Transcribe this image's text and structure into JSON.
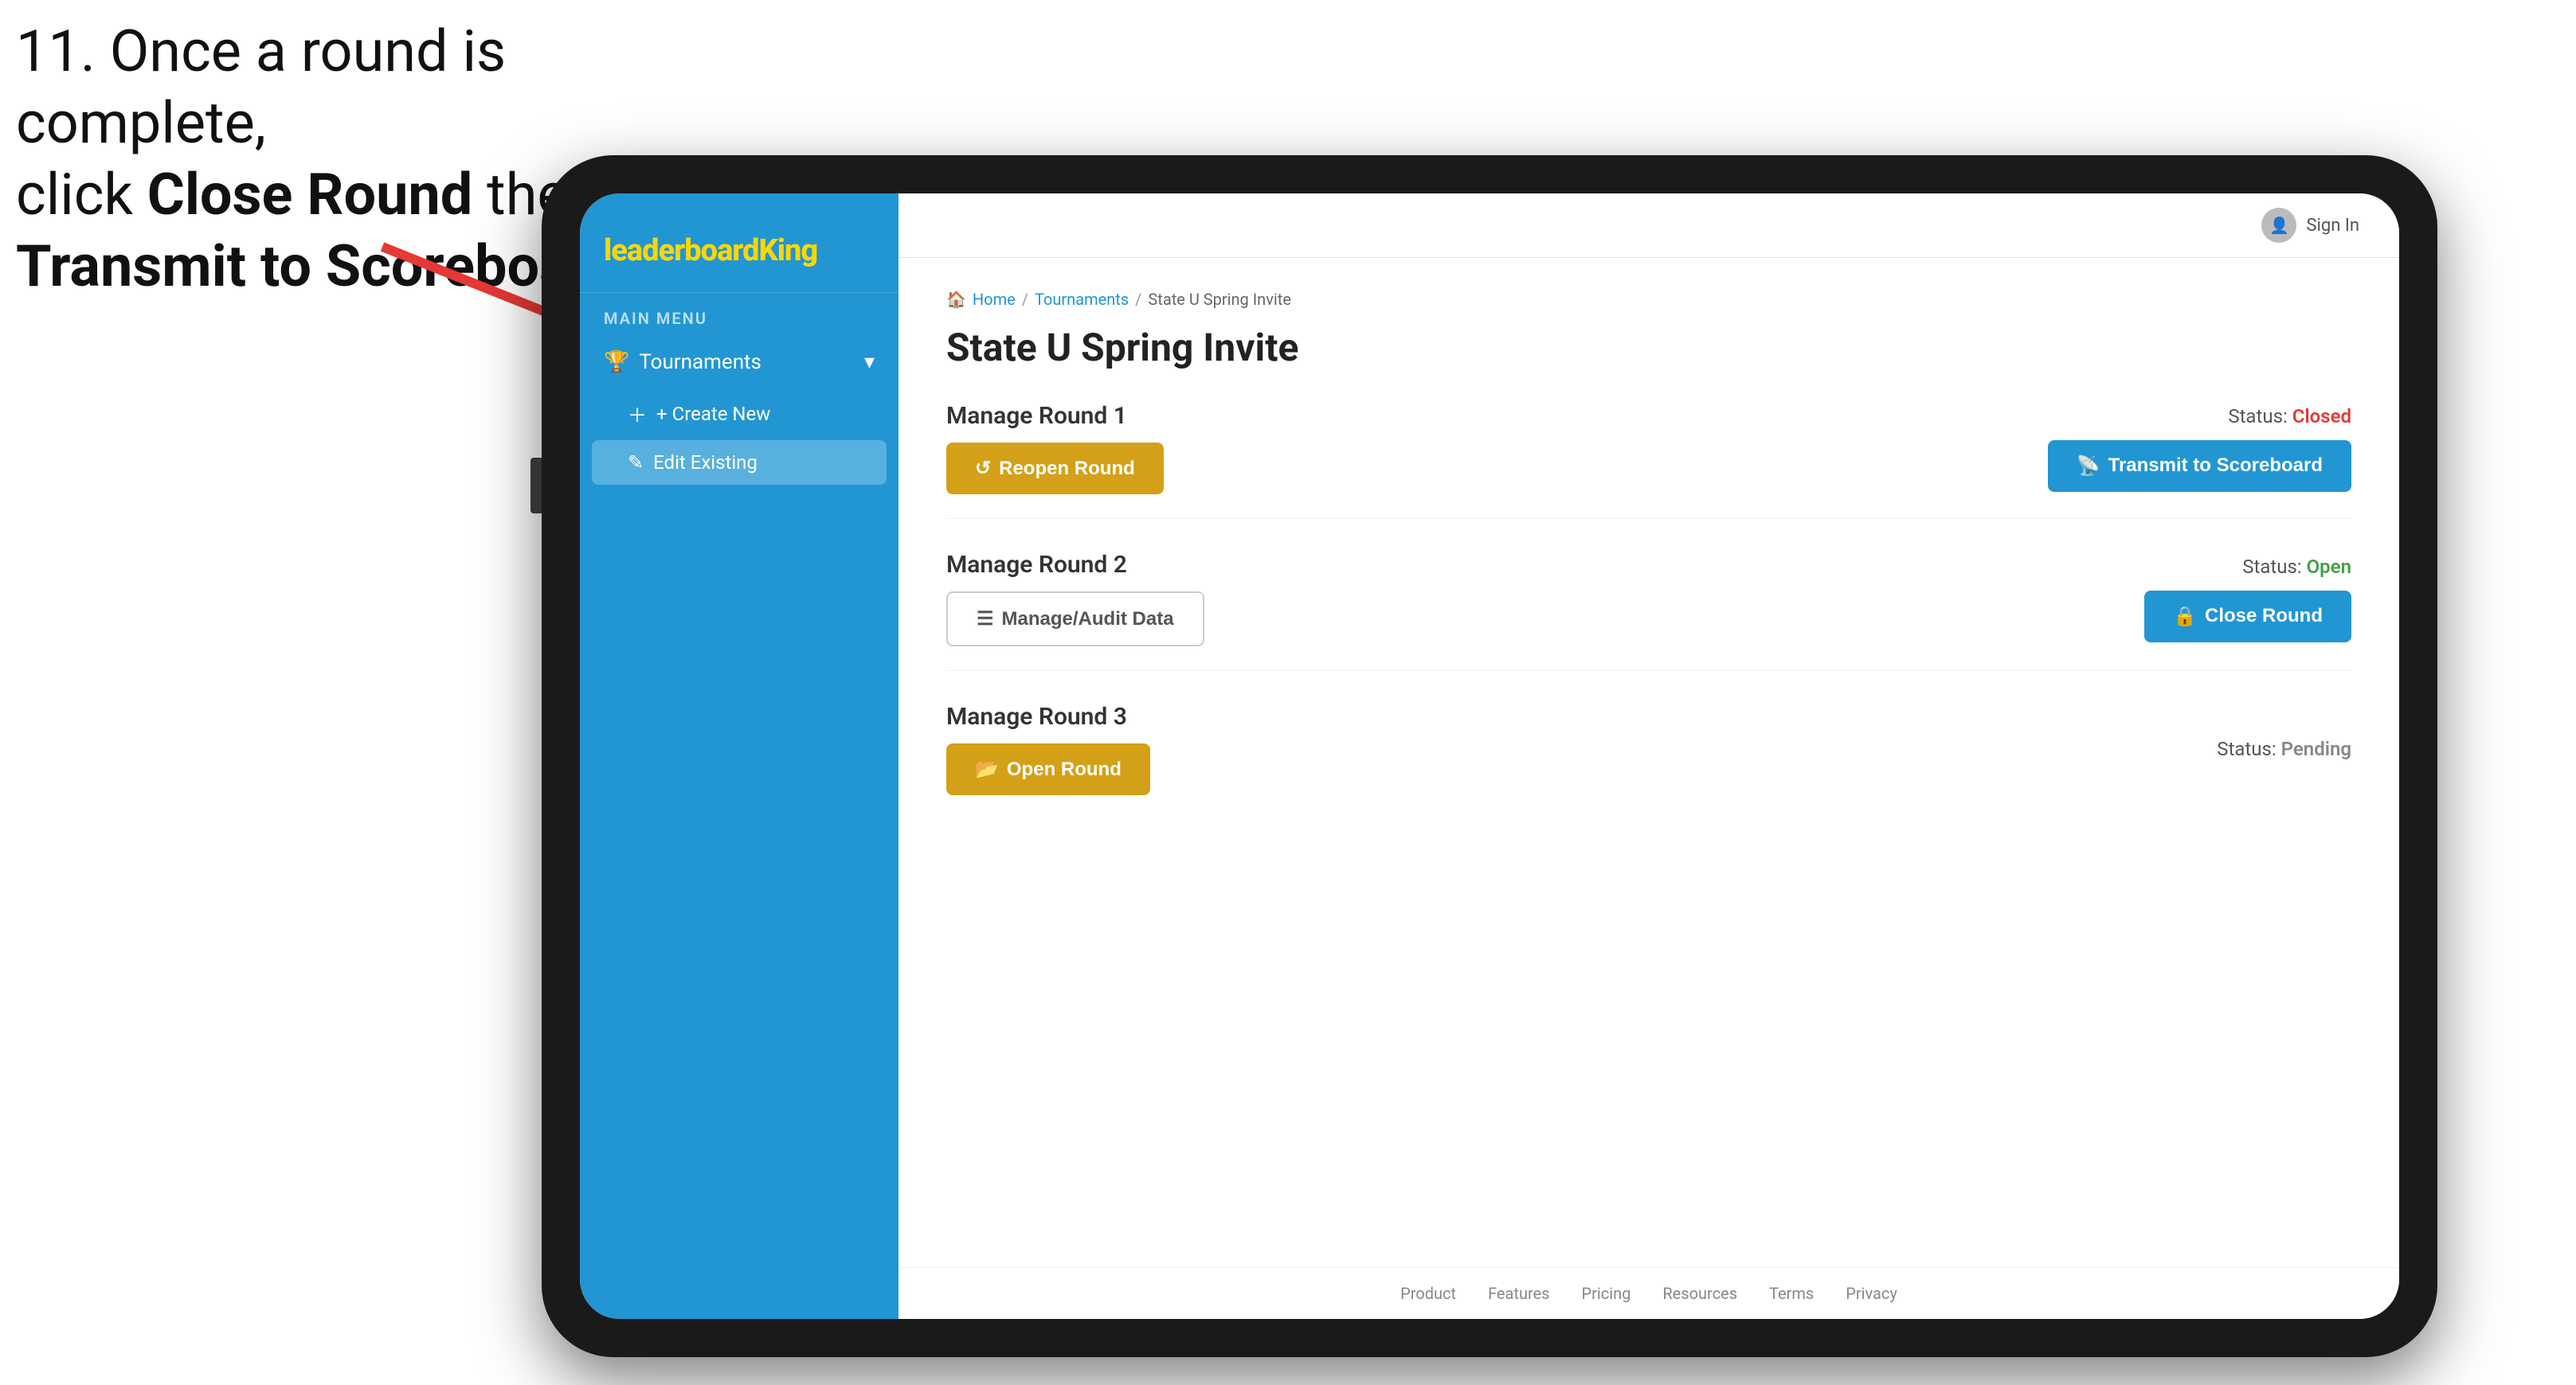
{
  "instruction": {
    "line1": "11. Once a round is complete,",
    "line2": "click ",
    "bold1": "Close Round",
    "line3": " then click",
    "bold2": "Transmit to Scoreboard."
  },
  "logo": {
    "text_regular": "leaderboard",
    "text_bold": "King"
  },
  "sidebar": {
    "main_menu_label": "MAIN MENU",
    "tournaments_label": "Tournaments",
    "chevron": "▾",
    "create_new_label": "+ Create New",
    "edit_existing_label": "Edit Existing"
  },
  "header": {
    "sign_in_label": "Sign In"
  },
  "breadcrumb": {
    "home": "Home",
    "sep1": "/",
    "tournaments": "Tournaments",
    "sep2": "/",
    "current": "State U Spring Invite"
  },
  "page": {
    "title": "State U Spring Invite",
    "round1": {
      "title": "Manage Round 1",
      "status_label": "Status:",
      "status_value": "Closed",
      "status_class": "status-closed",
      "reopen_label": "Reopen Round",
      "transmit_label": "Transmit to Scoreboard"
    },
    "round2": {
      "title": "Manage Round 2",
      "status_label": "Status:",
      "status_value": "Open",
      "status_class": "status-open",
      "audit_label": "Manage/Audit Data",
      "close_label": "Close Round"
    },
    "round3": {
      "title": "Manage Round 3",
      "status_label": "Status:",
      "status_value": "Pending",
      "status_class": "status-pending",
      "open_label": "Open Round"
    }
  },
  "footer": {
    "links": [
      "Product",
      "Features",
      "Pricing",
      "Resources",
      "Terms",
      "Privacy"
    ]
  }
}
